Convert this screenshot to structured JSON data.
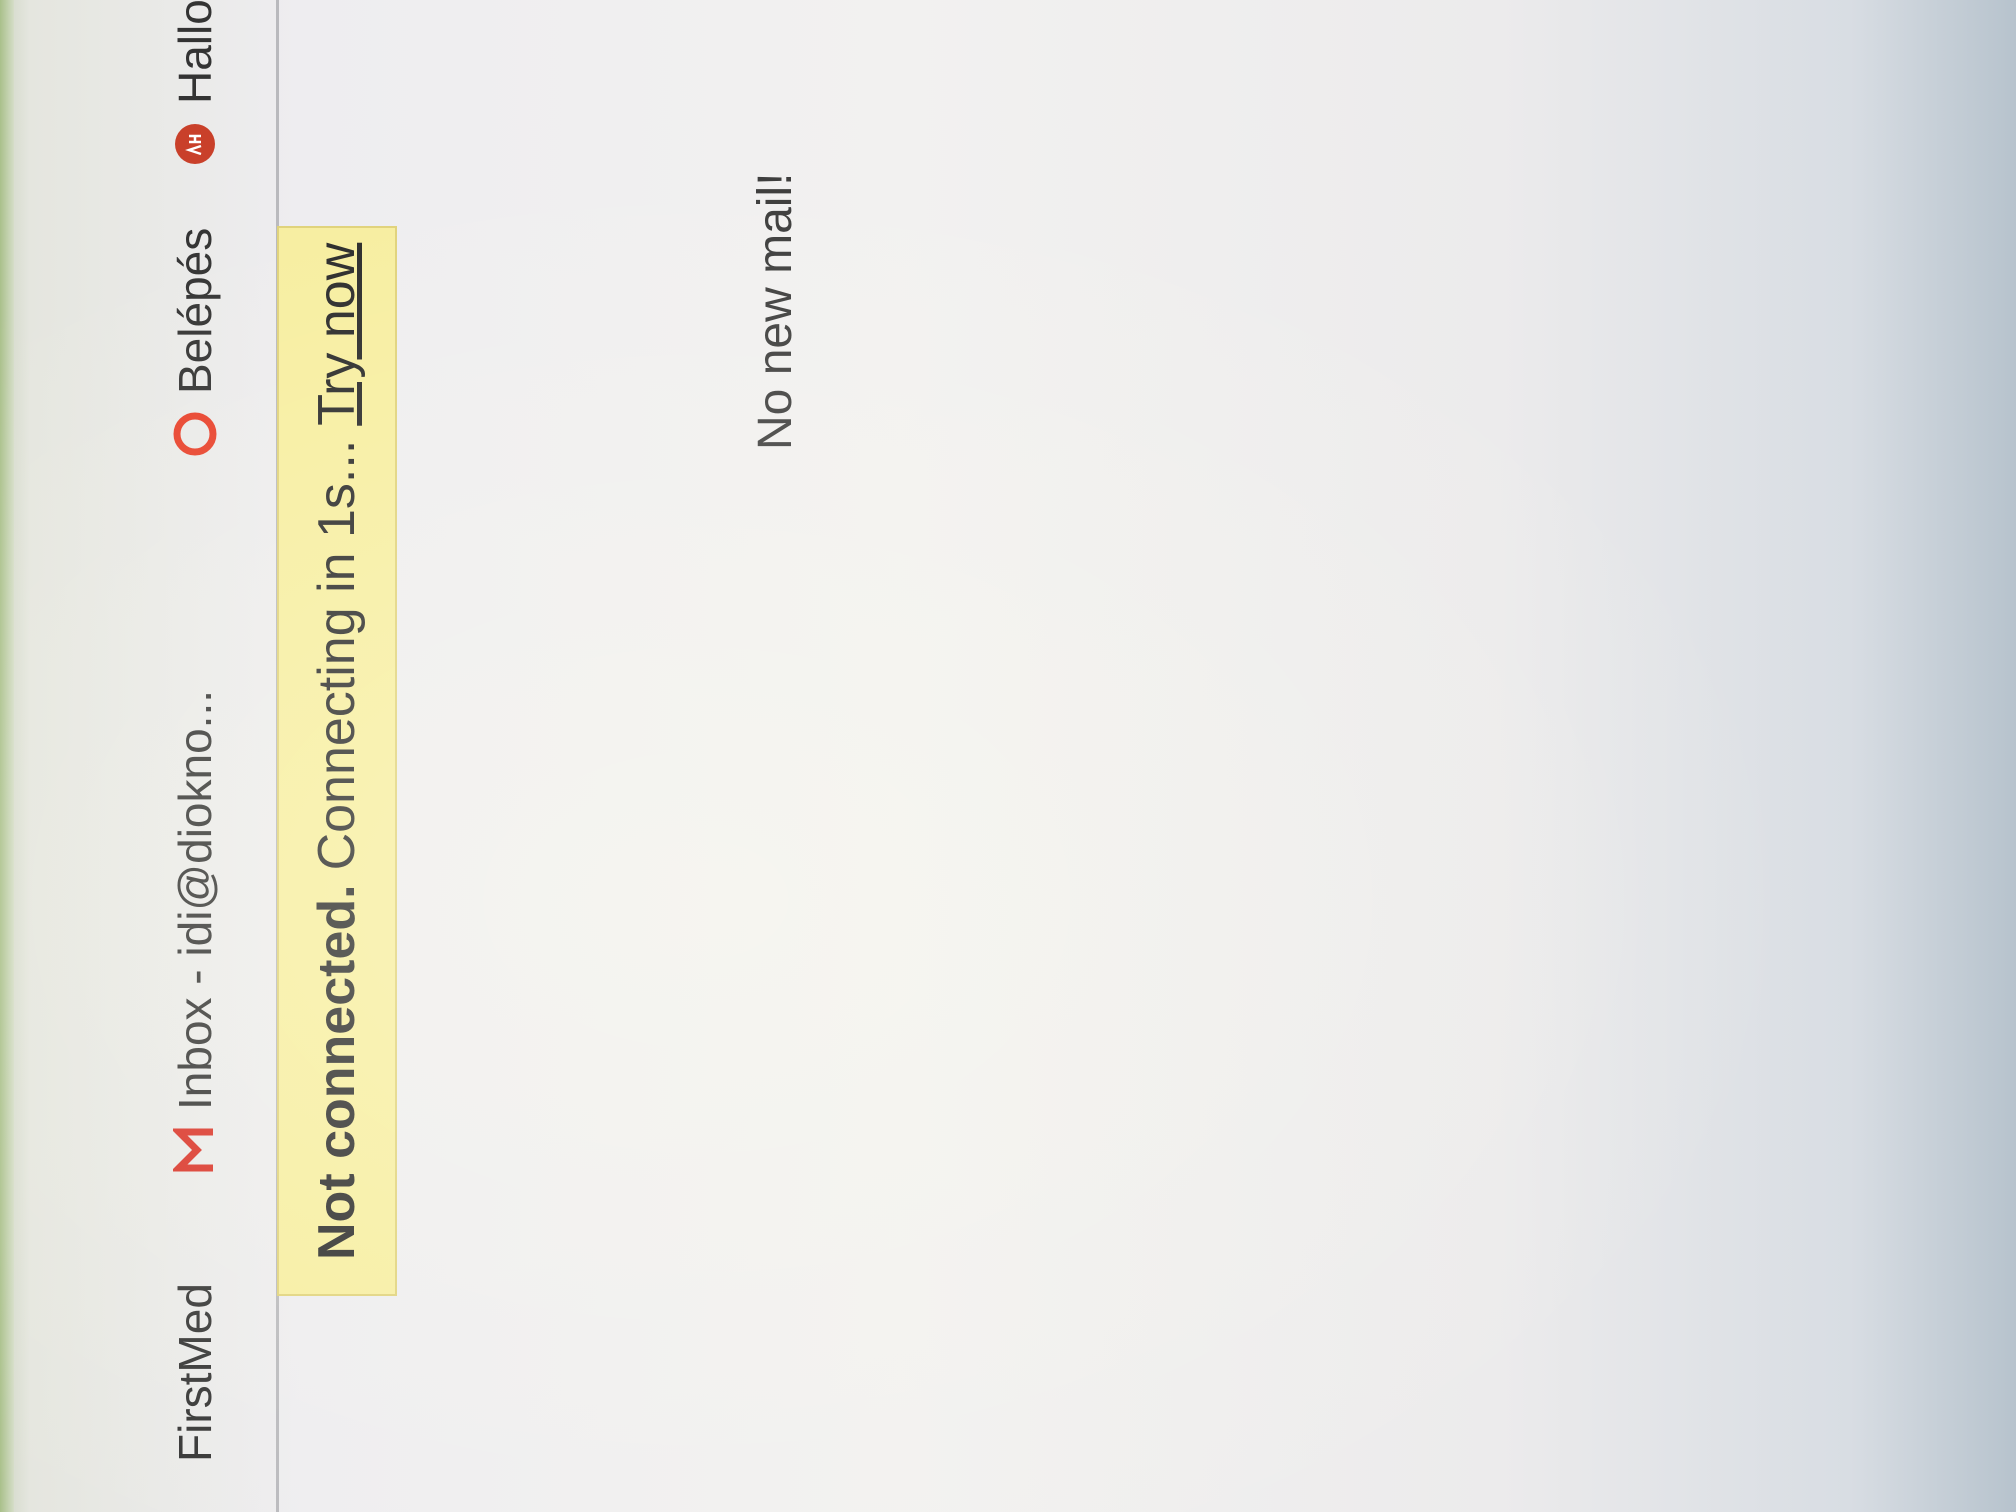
{
  "bookmarks": [
    {
      "label": "FirstMed",
      "icon": "none"
    },
    {
      "label": "Inbox - idi@diokno...",
      "icon": "gmail-icon"
    },
    {
      "label": "Belépés",
      "icon": "opera-icon"
    },
    {
      "label": "Halloween ke",
      "icon": "ah-icon"
    }
  ],
  "notice": {
    "status": "Not connected.",
    "message": "Connecting in 1s...",
    "action": "Try now",
    "background": "#f7eea0"
  },
  "mailbox": {
    "empty_message": "No new mail!"
  },
  "colors": {
    "gmail_red": "#d93025",
    "opera_red": "#e8402a",
    "ah_red": "#c9402a"
  }
}
